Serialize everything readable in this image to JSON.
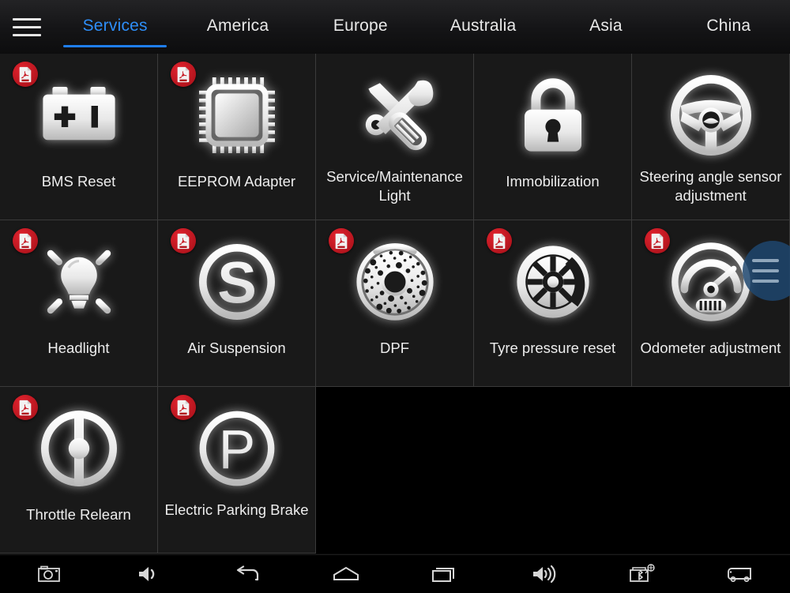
{
  "topbar": {
    "menu_icon": "hamburger-menu-icon",
    "tabs": [
      {
        "label": "Services",
        "active": true
      },
      {
        "label": "America",
        "active": false
      },
      {
        "label": "Europe",
        "active": false
      },
      {
        "label": "Australia",
        "active": false
      },
      {
        "label": "Asia",
        "active": false
      },
      {
        "label": "China",
        "active": false
      }
    ]
  },
  "colors": {
    "accent_blue": "#2e8ef7",
    "tab_underline": "#1f7ef0",
    "tile_bg": "#191919",
    "tile_border": "#3a3a3a",
    "badge_red": "#c6161f",
    "fab_blue": "#1e466e",
    "text": "#ededed",
    "page_bg": "#000000"
  },
  "grid": {
    "columns": 5,
    "rows": 3,
    "tiles": [
      {
        "label": "BMS Reset",
        "icon": "battery-icon",
        "pdf": true
      },
      {
        "label": "EEPROM Adapter",
        "icon": "chip-icon",
        "pdf": true
      },
      {
        "label": "Service/Maintenance Light",
        "icon": "tools-icon",
        "pdf": false
      },
      {
        "label": "Immobilization",
        "icon": "lock-icon",
        "pdf": false
      },
      {
        "label": "Steering angle sensor adjustment",
        "icon": "steering-wheel-icon",
        "pdf": false
      },
      {
        "label": "Headlight",
        "icon": "lightbulb-icon",
        "pdf": true
      },
      {
        "label": "Air Suspension",
        "icon": "suspension-s-icon",
        "pdf": true
      },
      {
        "label": "DPF",
        "icon": "particulate-filter-icon",
        "pdf": true
      },
      {
        "label": "Tyre pressure reset",
        "icon": "wheel-icon",
        "pdf": true
      },
      {
        "label": "Odometer adjustment",
        "icon": "speedometer-icon",
        "pdf": true
      },
      {
        "label": "Throttle Relearn",
        "icon": "throttle-body-icon",
        "pdf": true
      },
      {
        "label": "Electric Parking Brake",
        "icon": "parking-brake-p-icon",
        "pdf": true
      }
    ]
  },
  "fab": {
    "icon": "floating-menu-icon"
  },
  "navbar": {
    "buttons": [
      {
        "icon": "camera-icon",
        "name": "screenshot-button"
      },
      {
        "icon": "volume-down-icon",
        "name": "volume-down-button"
      },
      {
        "icon": "back-arrow-icon",
        "name": "back-button"
      },
      {
        "icon": "home-icon",
        "name": "home-button"
      },
      {
        "icon": "recent-apps-icon",
        "name": "recent-apps-button"
      },
      {
        "icon": "volume-up-icon",
        "name": "volume-up-button"
      },
      {
        "icon": "vci-bluetooth-icon",
        "name": "vci-connection-button"
      },
      {
        "icon": "vehicle-truck-icon",
        "name": "vehicle-button"
      }
    ]
  }
}
